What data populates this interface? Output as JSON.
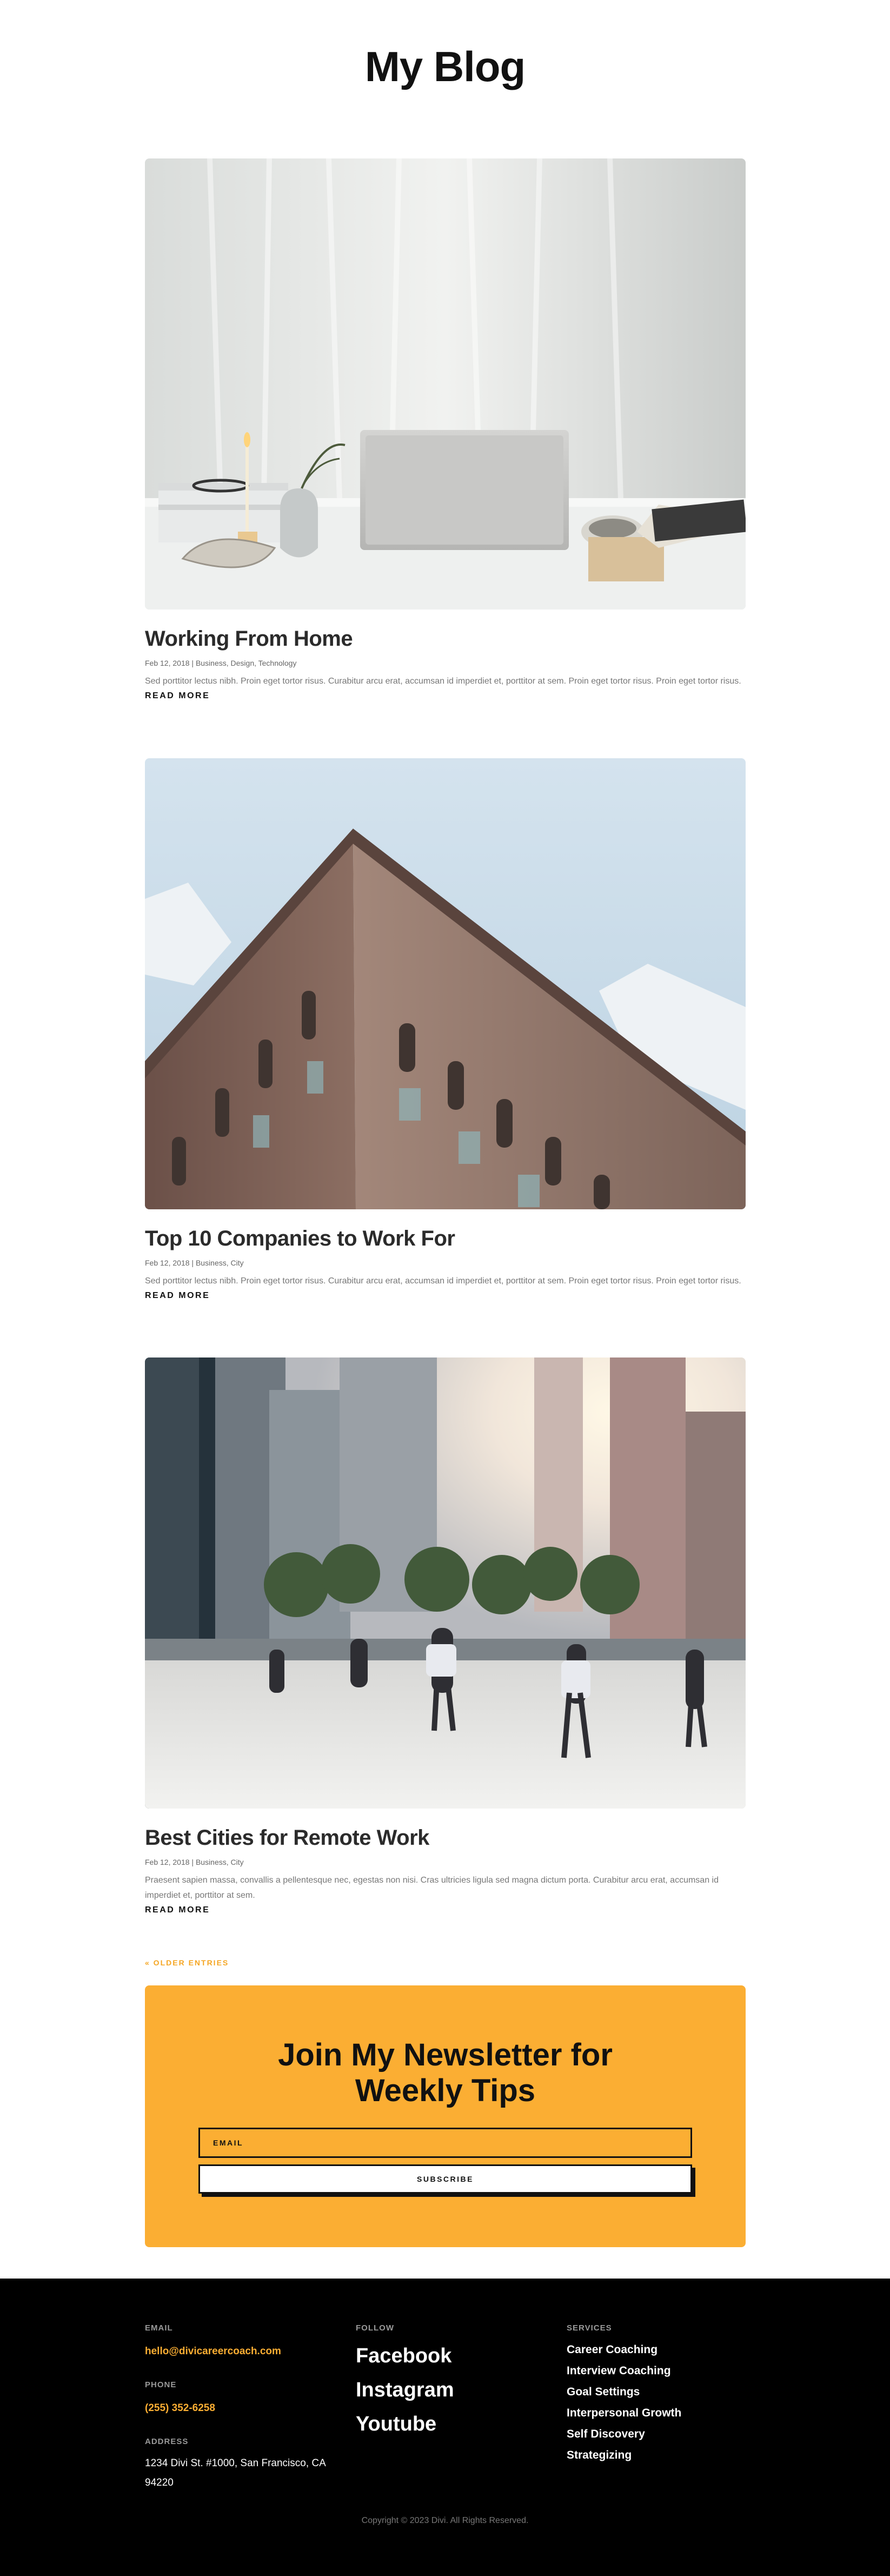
{
  "page": {
    "title": "My Blog"
  },
  "posts": [
    {
      "title": "Working From Home",
      "date": "Feb 12, 2018",
      "categories": "Business, Design, Technology",
      "excerpt": "Sed porttitor lectus nibh. Proin eget tortor risus. Curabitur arcu erat, accumsan id imperdiet et, porttitor at sem. Proin eget tortor risus. Proin eget tortor risus.",
      "read_more": "READ MORE"
    },
    {
      "title": "Top 10 Companies to Work For",
      "date": "Feb 12, 2018",
      "categories": "Business, City",
      "excerpt": "Sed porttitor lectus nibh. Proin eget tortor risus. Curabitur arcu erat, accumsan id imperdiet et, porttitor at sem. Proin eget tortor risus. Proin eget tortor risus.",
      "read_more": "READ MORE"
    },
    {
      "title": "Best Cities for Remote Work",
      "date": "Feb 12, 2018",
      "categories": "Business, City",
      "excerpt": "Praesent sapien massa, convallis a pellentesque nec, egestas non nisi. Cras ultricies ligula sed magna dictum porta. Curabitur arcu erat, accumsan id imperdiet et, porttitor at sem.",
      "read_more": "READ MORE"
    }
  ],
  "pagination": {
    "older_entries": "« OLDER ENTRIES"
  },
  "newsletter": {
    "heading": "Join My Newsletter for Weekly Tips",
    "email_placeholder": "EMAIL",
    "subscribe_label": "SUBSCRIBE",
    "background_color": "#fbae33"
  },
  "footer": {
    "email_label": "EMAIL",
    "email_value": "hello@divicareercoach.com",
    "phone_label": "PHONE",
    "phone_value": "(255) 352-6258",
    "address_label": "ADDRESS",
    "address_value": "1234 Divi St. #1000, San Francisco, CA 94220",
    "follow_label": "FOLLOW",
    "social": [
      "Facebook",
      "Instagram",
      "Youtube"
    ],
    "services_label": "SERVICES",
    "services": [
      "Career Coaching",
      "Interview Coaching",
      "Goal Settings",
      "Interpersonal Growth",
      "Self Discovery",
      "Strategizing"
    ],
    "copyright": "Copyright © 2023 Divi. All Rights Reserved.",
    "accent_color": "#fbae33"
  }
}
